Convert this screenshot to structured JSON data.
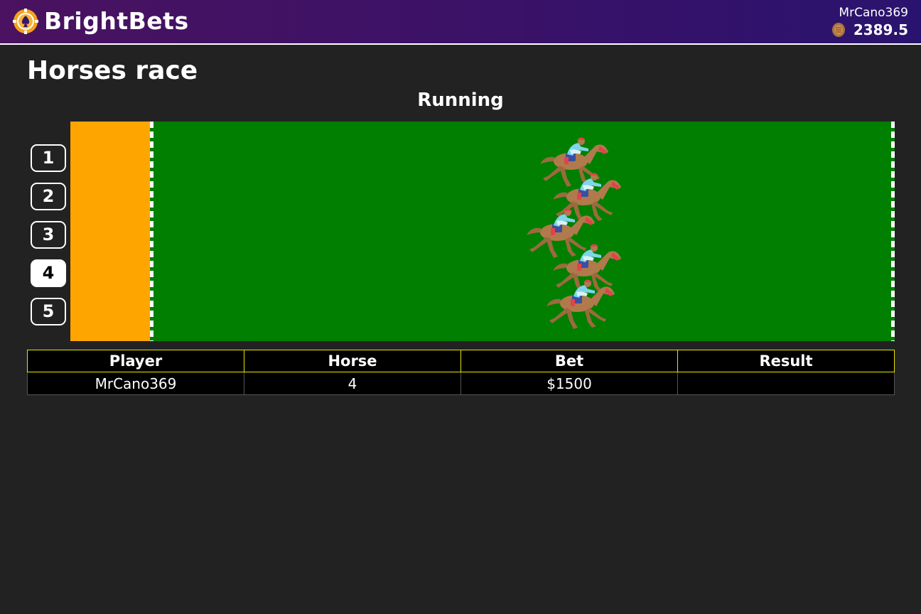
{
  "header": {
    "brand": "BrightBets",
    "logo_icon": "poker-chip-spade-icon",
    "username": "MrCano369",
    "balance": "2389.5",
    "coin_icon": "coin-icon"
  },
  "game": {
    "title": "Horses race",
    "status": "Running",
    "lane_buttons": [
      "1",
      "2",
      "3",
      "4",
      "5"
    ],
    "selected_lane": "4",
    "horse_icon": "horse-racing-icon",
    "horse_progress_of_track": [
      0.58,
      0.6,
      0.56,
      0.6,
      0.59
    ],
    "colors": {
      "track": "#007f00",
      "start_zone": "#ffa500",
      "header_gradient_start": "#4a1260",
      "header_gradient_end": "#2a136e",
      "table_header_border": "#e6e600"
    }
  },
  "bets_table": {
    "columns": [
      "Player",
      "Horse",
      "Bet",
      "Result"
    ],
    "rows": [
      [
        "MrCano369",
        "4",
        "$1500",
        ""
      ]
    ]
  }
}
